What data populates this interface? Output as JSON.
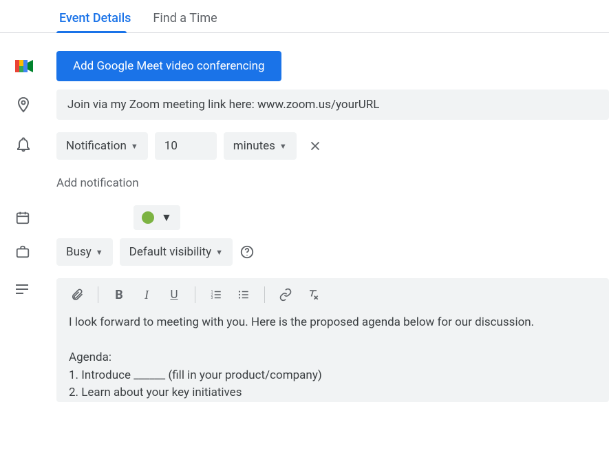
{
  "tabs": {
    "event_details": "Event Details",
    "find_a_time": "Find a Time"
  },
  "meet": {
    "button_label": "Add Google Meet video conferencing"
  },
  "location": {
    "value": "Join via my Zoom meeting link here: www.zoom.us/yourURL"
  },
  "notification": {
    "type_label": "Notification",
    "value": "10",
    "unit_label": "minutes",
    "add_label": "Add notification"
  },
  "calendar": {
    "color": "#7cb342"
  },
  "availability": {
    "busy_label": "Busy",
    "visibility_label": "Default visibility"
  },
  "description": {
    "text": "I look forward to meeting with you. Here is the proposed agenda below for our discussion.\n\nAgenda:\n1. Introduce ______ (fill in your product/company)\n2. Learn about your key initiatives"
  }
}
